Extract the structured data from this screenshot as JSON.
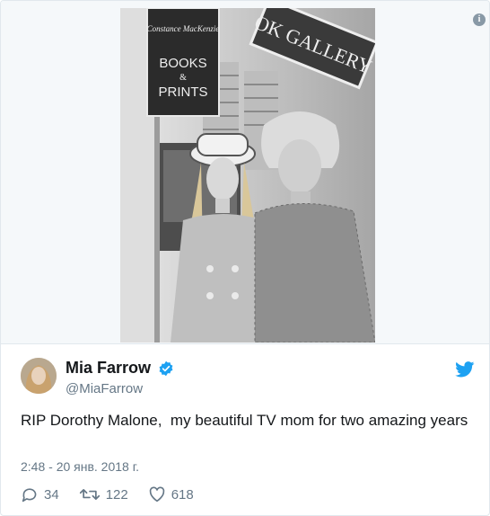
{
  "media": {
    "sign_books": "Constance MacKenzie",
    "sign_books_lines": [
      "BOOKS",
      "&",
      "PRINTS"
    ],
    "sign_gallery": "OK GALLERY"
  },
  "author": {
    "display_name": "Mia Farrow",
    "handle": "@MiaFarrow",
    "verified": true
  },
  "tweet": {
    "text": "RIP Dorothy Malone,  my beautiful TV mom for two amazing years",
    "timestamp": "2:48 - 20 янв. 2018 г."
  },
  "actions": {
    "reply_count": "34",
    "retweet_count": "122",
    "like_count": "618"
  },
  "colors": {
    "twitter_blue": "#1da1f2",
    "muted_text": "#657786",
    "border": "#e1e8ed"
  }
}
